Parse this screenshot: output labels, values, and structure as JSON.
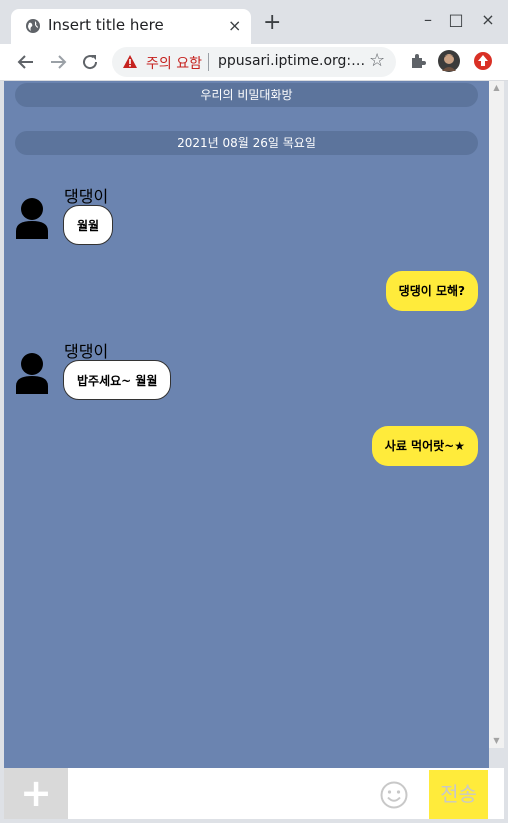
{
  "browser": {
    "tab_title": "Insert title here",
    "tab_close": "×",
    "new_tab": "+",
    "minimize": "–",
    "maximize": "□",
    "close": "×",
    "security_warning": "주의 요함",
    "url": "ppusari.iptime.org:…",
    "icons": [
      "globe-icon",
      "back-icon",
      "forward-icon",
      "reload-icon",
      "warning-icon",
      "star-icon",
      "puzzle-icon",
      "profile-icon",
      "update-icon"
    ]
  },
  "chat": {
    "room_title": "우리의 비밀대화방",
    "date": "2021년 08월 26일 목요일",
    "messages": [
      {
        "sender": "댕댕이",
        "text": "월월",
        "direction": "in"
      },
      {
        "text": "댕댕이 모해?",
        "direction": "out"
      },
      {
        "sender": "댕댕이",
        "text": "밥주세요~ 월월",
        "direction": "in"
      },
      {
        "text": "사료 먹어랏~★",
        "direction": "out"
      }
    ]
  },
  "composer": {
    "plus_label": "+",
    "input_value": "",
    "send_label": "전송"
  },
  "colors": {
    "chat_bg": "#6b84b0",
    "pill_bg": "#5c749c",
    "out_bubble": "#ffeb3b",
    "send_button": "#ffeb3b"
  }
}
